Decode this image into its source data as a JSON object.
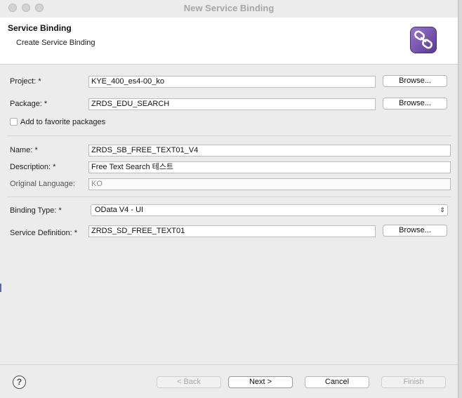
{
  "window": {
    "title": "New Service Binding"
  },
  "header": {
    "title": "Service Binding",
    "subtitle": "Create Service Binding",
    "icon": "service-binding-link-icon"
  },
  "form": {
    "project": {
      "label": "Project: *",
      "value": "KYE_400_es4-00_ko",
      "browse_label": "Browse..."
    },
    "package": {
      "label": "Package: *",
      "value": "ZRDS_EDU_SEARCH",
      "browse_label": "Browse..."
    },
    "favorite": {
      "label": "Add to favorite packages",
      "checked": false
    },
    "name": {
      "label": "Name: *",
      "value": "ZRDS_SB_FREE_TEXT01_V4"
    },
    "description": {
      "label": "Description: *",
      "value": "Free Text Search 테스트"
    },
    "original_language": {
      "label": "Original Language:",
      "value": "KO"
    },
    "binding_type": {
      "label": "Binding Type: *",
      "value": "OData V4 - UI"
    },
    "service_definition": {
      "label": "Service Definition: *",
      "value": "ZRDS_SD_FREE_TEXT01",
      "browse_label": "Browse..."
    }
  },
  "footer": {
    "help": "?",
    "back": "< Back",
    "next": "Next >",
    "cancel": "Cancel",
    "finish": "Finish"
  }
}
